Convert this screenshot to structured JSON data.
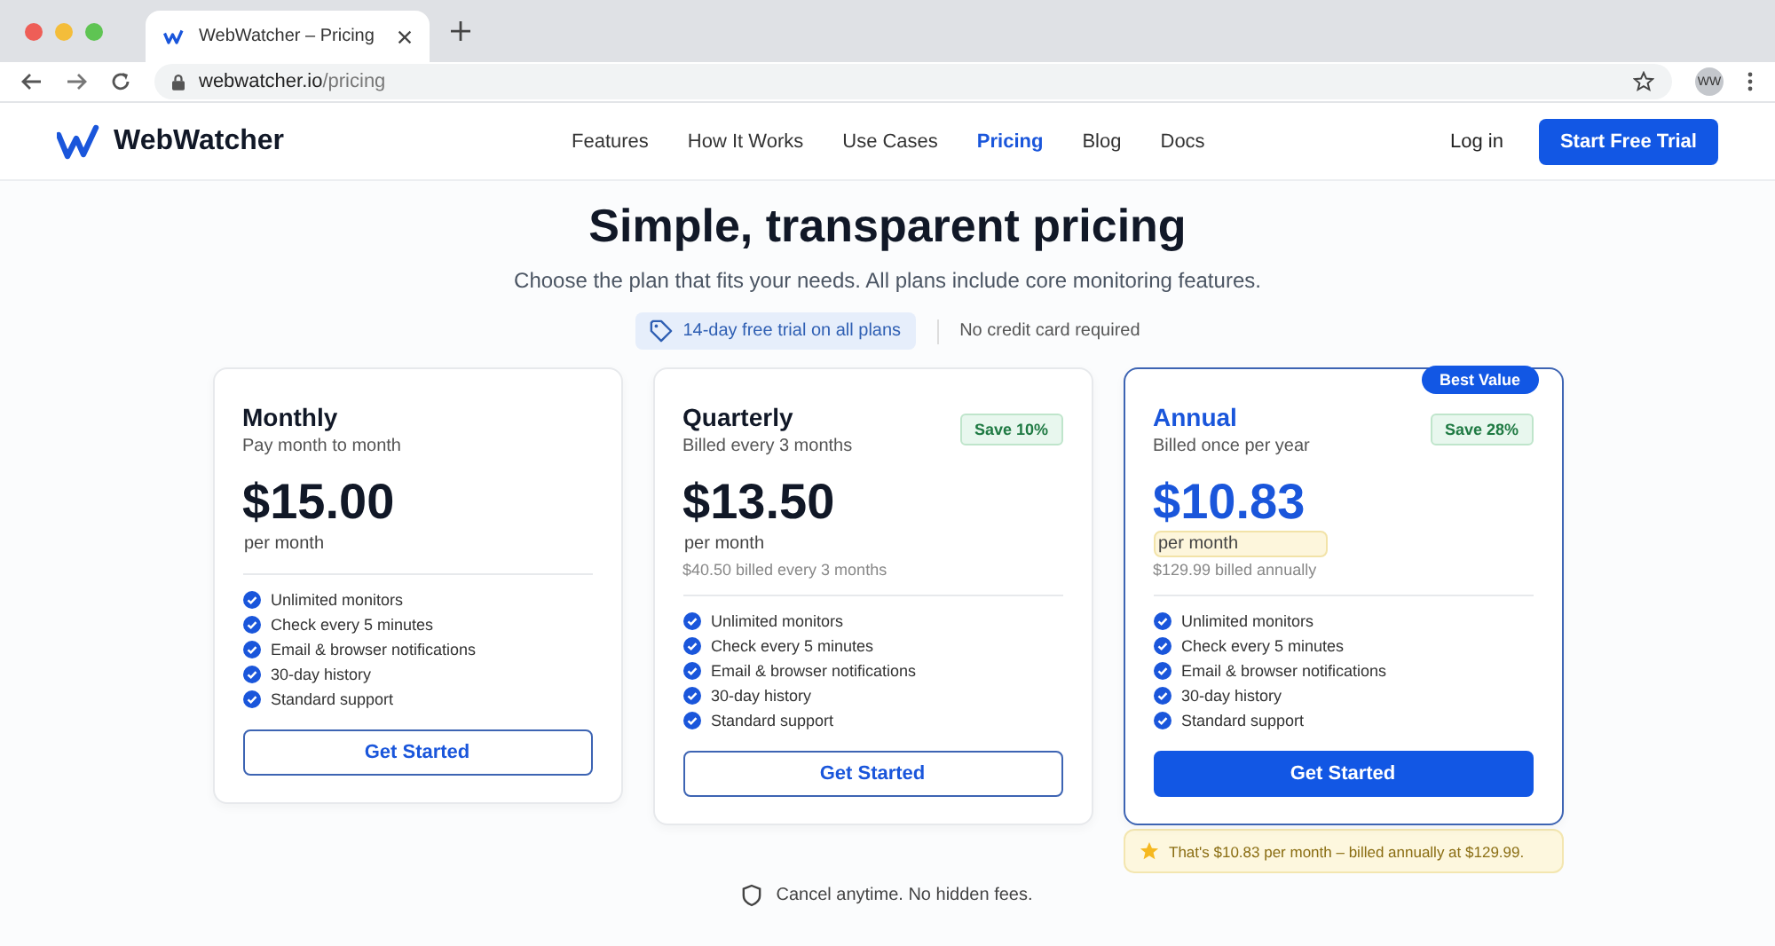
{
  "browser": {
    "tab_title": "WebWatcher – Pricing",
    "url_host": "webwatcher.io",
    "url_path": "/pricing",
    "avatar": "WW"
  },
  "header": {
    "brand": "WebWatcher",
    "nav": [
      {
        "label": "Features",
        "selected": false
      },
      {
        "label": "How It Works",
        "selected": false
      },
      {
        "label": "Use Cases",
        "selected": false
      },
      {
        "label": "Pricing",
        "selected": true
      },
      {
        "label": "Blog",
        "selected": false
      },
      {
        "label": "Docs",
        "selected": false
      }
    ],
    "login": "Log in",
    "cta": "Start Free Trial"
  },
  "hero": {
    "title": "Simple, transparent pricing",
    "subtitle": "Choose the plan that fits your needs. All plans include core monitoring features.",
    "trial": "14-day free trial on all plans",
    "no_card": "No credit card required"
  },
  "plans": [
    {
      "name": "Monthly",
      "billing": "Pay month to month",
      "price": "$15.00",
      "unit": "per month",
      "featured": false,
      "features": [
        "Unlimited monitors",
        "Check every 5 minutes",
        "Email & browser notifications",
        "30-day history",
        "Standard support"
      ],
      "button": "Get Started"
    },
    {
      "name": "Quarterly",
      "billing": "Billed every 3 months",
      "save": "Save 10%",
      "price": "$13.50",
      "unit": "per month",
      "total": "$40.50 billed every 3 months",
      "featured": false,
      "features": [
        "Unlimited monitors",
        "Check every 5 minutes",
        "Email & browser notifications",
        "30-day history",
        "Standard support"
      ],
      "button": "Get Started"
    },
    {
      "name": "Annual",
      "billing": "Billed once per year",
      "save": "Save 28%",
      "badge": "Best Value",
      "price": "$10.83",
      "unit": "per month",
      "total": "$129.99 billed annually",
      "featured": true,
      "features": [
        "Unlimited monitors",
        "Check every 5 minutes",
        "Email & browser notifications",
        "30-day history",
        "Standard support"
      ],
      "button": "Get Started",
      "note": "That's $10.83 per month – billed annually at $129.99."
    }
  ],
  "footer_note": "Cancel anytime. No hidden fees."
}
